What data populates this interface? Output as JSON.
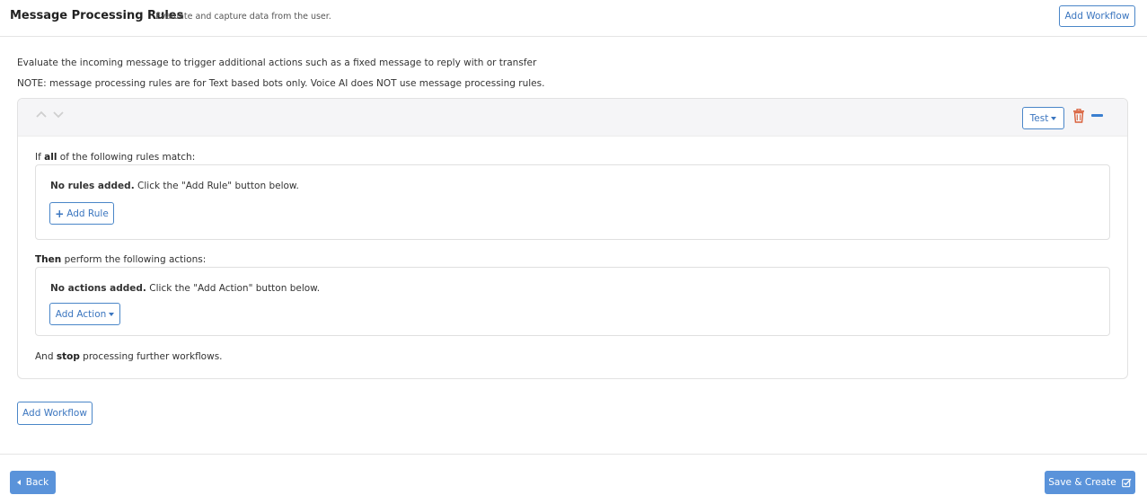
{
  "header": {
    "title": "Message Processing Rules",
    "subtitle": "Evaluate and capture data from the user.",
    "add_workflow_label": "Add Workflow"
  },
  "intro": {
    "line1": "Evaluate the incoming message to trigger additional actions such as a fixed message to reply with or transfer",
    "line2": "NOTE: message processing rules are for Text based bots only. Voice AI does NOT use message processing rules."
  },
  "workflow": {
    "test_label": "Test",
    "rules": {
      "prefix": "If ",
      "bold": "all",
      "suffix": " of the following rules match:",
      "empty_bold": "No rules added.",
      "empty_text": " Click the \"Add Rule\" button below.",
      "add_rule_label": "Add Rule"
    },
    "actions": {
      "bold": "Then",
      "suffix": " perform the following actions:",
      "empty_bold": "No actions added.",
      "empty_text": " Click the \"Add Action\" button below.",
      "add_action_label": "Add Action"
    },
    "stop": {
      "prefix": "And ",
      "bold": "stop",
      "suffix": " processing further workflows."
    }
  },
  "add_workflow_bottom_label": "Add Workflow",
  "footer": {
    "back_label": "Back",
    "save_label": "Save & Create"
  },
  "colors": {
    "accent": "#3a75bf",
    "primary_button": "#5a93da",
    "trash": "#d9603b"
  }
}
